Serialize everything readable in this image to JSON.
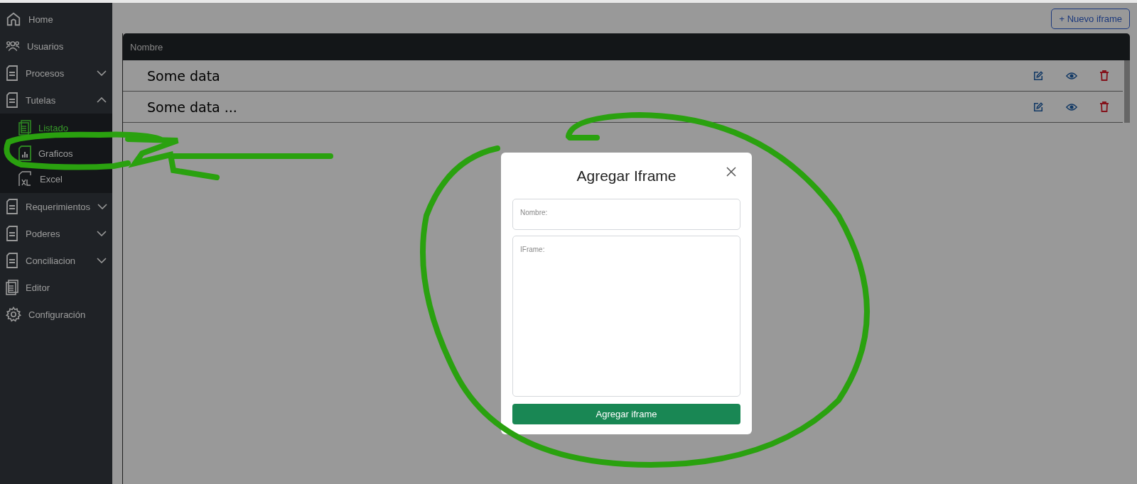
{
  "sidebar": {
    "items": [
      {
        "kind": "link",
        "label": "Home"
      },
      {
        "kind": "link",
        "label": "Usuarios"
      },
      {
        "kind": "group",
        "label": "Procesos",
        "expanded": false
      },
      {
        "kind": "group",
        "label": "Tutelas",
        "expanded": true,
        "children": [
          {
            "label": "Listado",
            "selected": true
          },
          {
            "label": "Graficos",
            "selected": false
          },
          {
            "label": "Excel",
            "selected": false
          }
        ]
      },
      {
        "kind": "group",
        "label": "Requerimientos",
        "expanded": false
      },
      {
        "kind": "group",
        "label": "Poderes",
        "expanded": false
      },
      {
        "kind": "group",
        "label": "Conciliacion",
        "expanded": false
      },
      {
        "kind": "link",
        "label": "Editor"
      },
      {
        "kind": "link",
        "label": "Configuración"
      }
    ]
  },
  "new_button": "+ Nuevo iframe",
  "table": {
    "columns": [
      "Nombre"
    ],
    "rows": [
      {
        "name": "Some data"
      },
      {
        "name": "Some data ..."
      }
    ]
  },
  "modal": {
    "title": "Agregar Iframe",
    "fields": [
      {
        "kind": "input",
        "placeholder": "Nombre:"
      },
      {
        "kind": "textarea",
        "placeholder": "IFrame:"
      }
    ],
    "submit": "Agregar iframe"
  }
}
